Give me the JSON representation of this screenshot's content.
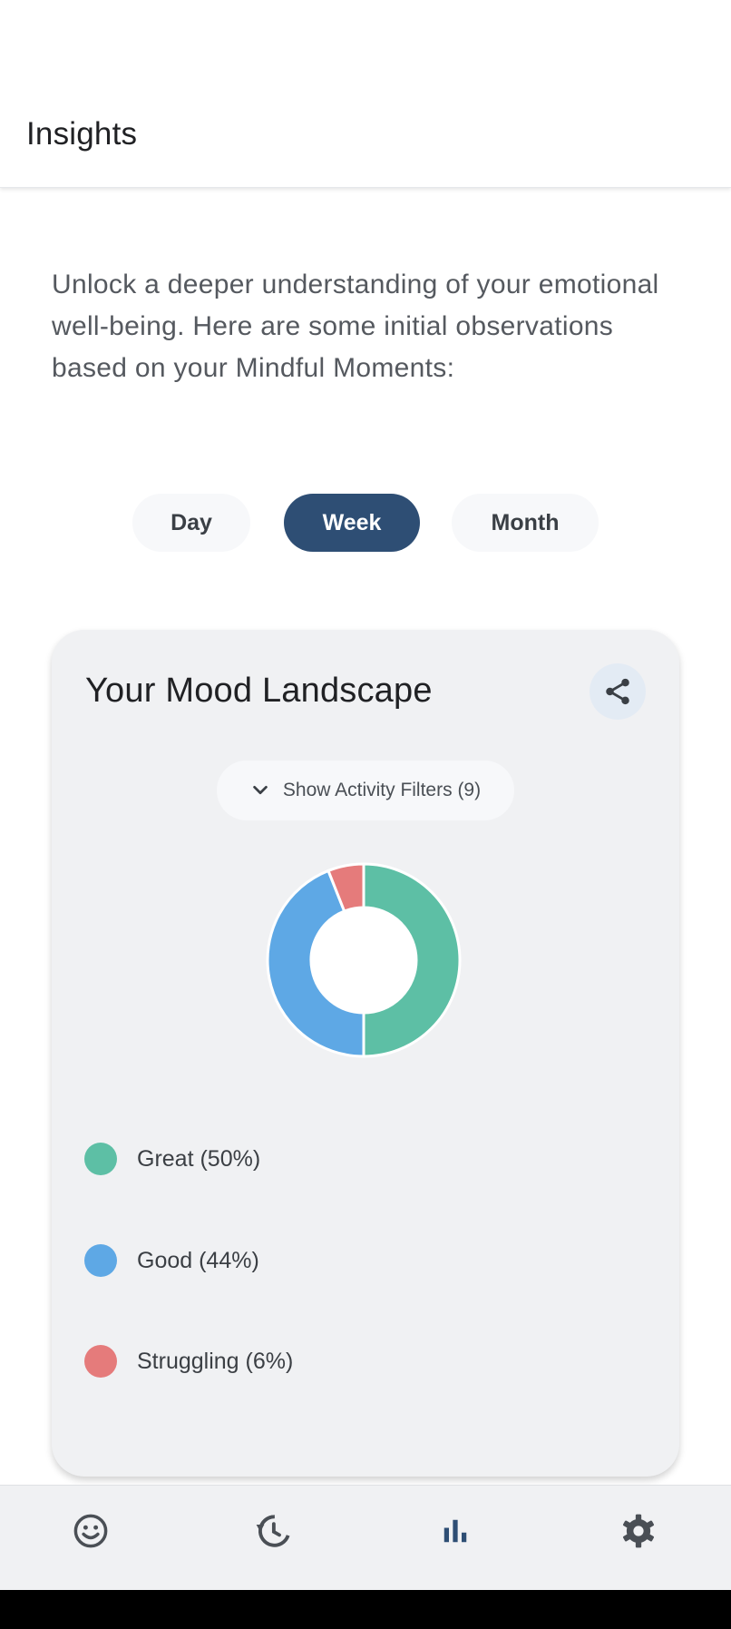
{
  "header": {
    "title": "Insights"
  },
  "intro": {
    "text": "Unlock a deeper understanding of your emotional well-being. Here are some initial observations based on your Mindful Moments:"
  },
  "period_tabs": [
    {
      "label": "Day",
      "active": false
    },
    {
      "label": "Week",
      "active": true
    },
    {
      "label": "Month",
      "active": false
    }
  ],
  "card": {
    "title": "Your Mood Landscape",
    "share_icon": "share-icon",
    "filter_label": "Show Activity Filters (9)",
    "filter_icon": "chevron-down-icon"
  },
  "chart_data": {
    "type": "pie",
    "categories": [
      "Great",
      "Good",
      "Struggling"
    ],
    "values": [
      50,
      44,
      6
    ],
    "colors": [
      "#5dbfa5",
      "#5ea8e5",
      "#e57b7b"
    ],
    "legend": [
      "Great (50%)",
      "Good (44%)",
      "Struggling (6%)"
    ]
  },
  "bottom_nav": [
    {
      "name": "mood-smiley-icon",
      "active": false
    },
    {
      "name": "history-icon",
      "active": false
    },
    {
      "name": "insights-bar-chart-icon",
      "active": true
    },
    {
      "name": "settings-gear-icon",
      "active": false
    }
  ],
  "colors": {
    "accent": "#2e4e74",
    "nav_icon": "#4a4f55",
    "nav_active": "#2e4e74"
  }
}
